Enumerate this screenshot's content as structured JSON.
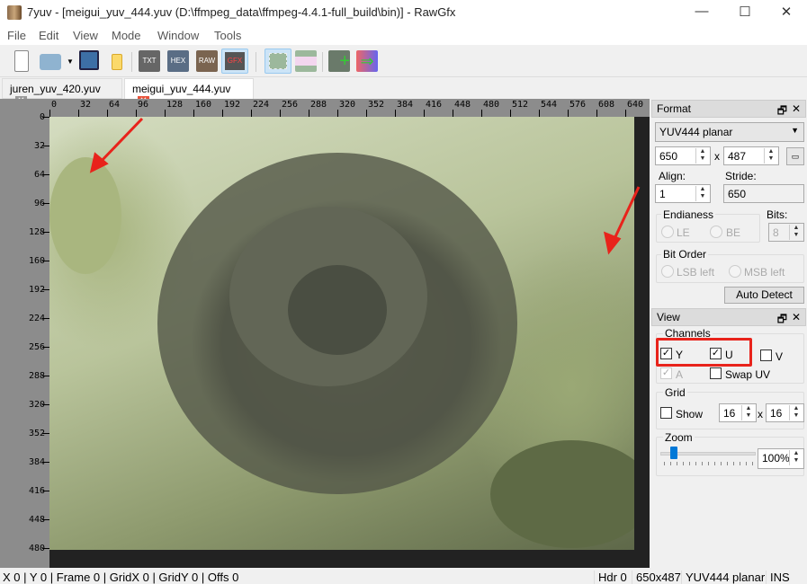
{
  "window": {
    "title": "7yuv - [meigui_yuv_444.yuv (D:\\ffmpeg_data\\ffmpeg-4.4.1-full_build\\bin)] - RawGfx",
    "minimize": "—",
    "maximize": "☐",
    "close": "✕"
  },
  "menu": [
    "File",
    "Edit",
    "View",
    "Mode",
    "Window",
    "Tools"
  ],
  "toolbar": {
    "txt": "TXT",
    "hex": "HEX",
    "raw": "RAW",
    "gfx": "GFX"
  },
  "tabs": [
    {
      "label": "juren_yuv_420.yuv",
      "active": false
    },
    {
      "label": "meigui_yuv_444.yuv",
      "active": true
    }
  ],
  "ruler": {
    "top": [
      "0",
      "32",
      "64",
      "96",
      "128",
      "160",
      "192",
      "224",
      "256",
      "288",
      "320",
      "352",
      "384",
      "416",
      "448",
      "480",
      "512",
      "544",
      "576",
      "608",
      "640"
    ],
    "left": [
      "0",
      "32",
      "64",
      "96",
      "128",
      "160",
      "192",
      "224",
      "256",
      "288",
      "320",
      "352",
      "384",
      "416",
      "448",
      "480"
    ]
  },
  "format_panel": {
    "title": "Format",
    "format": "YUV444 planar",
    "width": "650",
    "x": "x",
    "height": "487",
    "align_label": "Align:",
    "align": "1",
    "stride_label": "Stride:",
    "stride": "650",
    "endianess_label": "Endianess",
    "le": "LE",
    "be": "BE",
    "bits_label": "Bits:",
    "bits": "8",
    "bit_order_label": "Bit Order",
    "lsb": "LSB left",
    "msb": "MSB left",
    "auto_detect": "Auto Detect"
  },
  "view_panel": {
    "title": "View",
    "channels_label": "Channels",
    "y": "Y",
    "y_checked": true,
    "u": "U",
    "u_checked": true,
    "v": "V",
    "v_checked": false,
    "a": "A",
    "a_checked": true,
    "swap_uv": "Swap UV",
    "swap_checked": false,
    "grid_label": "Grid",
    "show": "Show",
    "show_checked": false,
    "grid_x": "16",
    "grid_y": "16",
    "zoom_label": "Zoom",
    "zoom": "100%",
    "zoom_level_fraction": 0.1
  },
  "status": {
    "left": "X 0 | Y 0 | Frame 0 | GridX 0 | GridY 0 | Offs 0",
    "hdr": "Hdr 0",
    "size": "650x487",
    "format": "YUV444 planar",
    "mode": "INS"
  },
  "colors": {
    "annotation": "#e8231b",
    "accent": "#0078d7"
  }
}
